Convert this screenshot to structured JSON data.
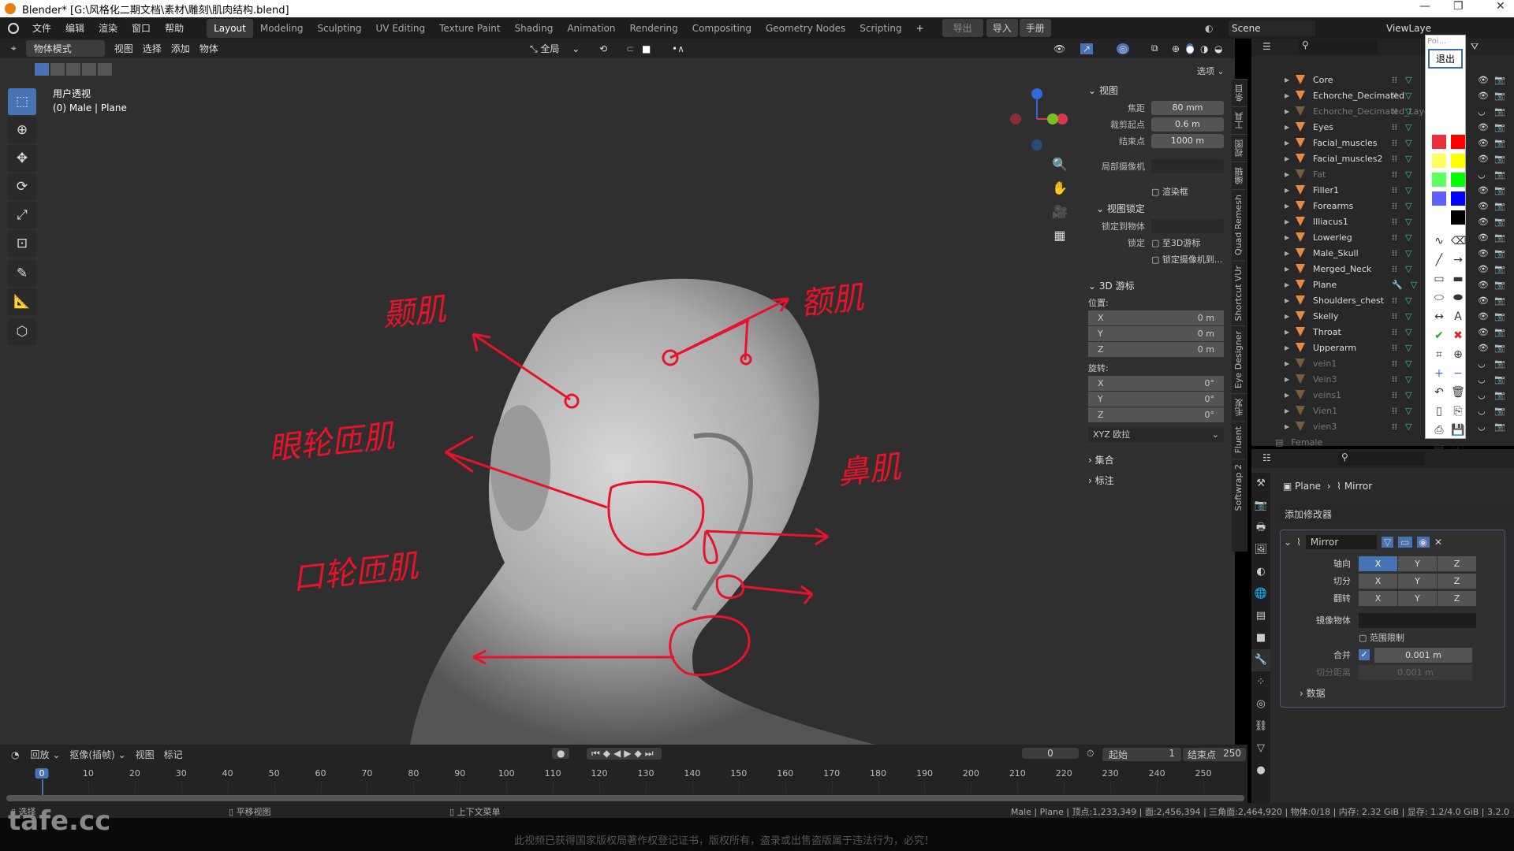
{
  "window": {
    "title": "Blender* [G:\\风格化二期文档\\素材\\雕刻\\肌肉结构.blend]",
    "minimize": "—",
    "restore": "❐",
    "close": "✕"
  },
  "menu": [
    "文件",
    "编辑",
    "渲染",
    "窗口",
    "帮助"
  ],
  "workspaces": [
    {
      "label": "Layout",
      "active": true
    },
    {
      "label": "Modeling"
    },
    {
      "label": "Sculpting"
    },
    {
      "label": "UV Editing"
    },
    {
      "label": "Texture Paint"
    },
    {
      "label": "Shading"
    },
    {
      "label": "Animation"
    },
    {
      "label": "Rendering"
    },
    {
      "label": "Compositing"
    },
    {
      "label": "Geometry Nodes"
    },
    {
      "label": "Scripting"
    }
  ],
  "topbar": {
    "add_ws": "+",
    "export": "导出",
    "import": "导入",
    "manual": "手册",
    "scene": "Scene",
    "view_layer": "ViewLaye"
  },
  "vp_header": {
    "mode": "物体模式",
    "items": [
      "视图",
      "选择",
      "添加",
      "物体"
    ],
    "transform": "全局",
    "options": "选项"
  },
  "viewport": {
    "view_name": "用户透视",
    "object_info": "(0) Male | Plane",
    "annotations": {
      "temporalis": "颞肌",
      "frontalis": "额肌",
      "orbicularis_oculi": "眼轮匝肌",
      "nasalis": "鼻肌",
      "orbicularis_oris": "口轮匝肌"
    },
    "annotation_color": "#e8132a",
    "gizmo": {
      "x": "X",
      "y": "Y",
      "z": "Z"
    }
  },
  "npanel": {
    "view": {
      "title": "视图",
      "focal_label": "焦距",
      "focal": "80 mm",
      "clip_start_label": "裁剪起点",
      "clip_start": "0.6 m",
      "clip_end_label": "结束点",
      "clip_end": "1000 m",
      "local_camera": "局部摄像机",
      "render_region": "渲染框",
      "lock": {
        "title": "视图锁定",
        "lock_object": "锁定到物体",
        "lock_label": "锁定",
        "to_cursor": "至3D游标",
        "lock_camera": "锁定摄像机到..."
      }
    },
    "cursor": {
      "title": "3D 游标",
      "location": "位置:",
      "loc": [
        {
          "axis": "X",
          "value": "0 m"
        },
        {
          "axis": "Y",
          "value": "0 m"
        },
        {
          "axis": "Z",
          "value": "0 m"
        }
      ],
      "rotation": "旋转:",
      "rot": [
        {
          "axis": "X",
          "value": "0°"
        },
        {
          "axis": "Y",
          "value": "0°"
        },
        {
          "axis": "Z",
          "value": "0°"
        }
      ],
      "mode": "XYZ 欧拉"
    },
    "collections": "集合",
    "annotations": "标注"
  },
  "ntabs": [
    "条目",
    "工具",
    "视图",
    "编辑",
    "Quad Remesh",
    "Shortcut VUr",
    "Eye Designer",
    "毛发",
    "Fluent",
    "Softwrap 2"
  ],
  "outliner": {
    "items": [
      {
        "name": "Core"
      },
      {
        "name": "Echorche_Decimated"
      },
      {
        "name": "Echorche_Decimated_Layer",
        "dim": true
      },
      {
        "name": "Eyes"
      },
      {
        "name": "Facial_muscles"
      },
      {
        "name": "Facial_muscles2"
      },
      {
        "name": "Fat",
        "dim": true
      },
      {
        "name": "Filler1"
      },
      {
        "name": "Forearms"
      },
      {
        "name": "Illiacus1"
      },
      {
        "name": "Lowerleg"
      },
      {
        "name": "Male_Skull"
      },
      {
        "name": "Merged_Neck"
      },
      {
        "name": "Plane",
        "modifier": "wrench-icon"
      },
      {
        "name": "Shoulders_chest"
      },
      {
        "name": "Skelly"
      },
      {
        "name": "Throat"
      },
      {
        "name": "Upperarm"
      },
      {
        "name": "vein1",
        "dim": true
      },
      {
        "name": "Vein3",
        "dim": true
      },
      {
        "name": "veins1",
        "dim": true
      },
      {
        "name": "Vien1",
        "dim": true
      },
      {
        "name": "vien3",
        "dim": true
      }
    ],
    "collection": "Female"
  },
  "palette": {
    "title": "Poi...",
    "exit": "退出",
    "colors": [
      "#e8303a",
      "#ff0000",
      "#ffff60",
      "#ffff00",
      "#60ff60",
      "#00ff00",
      "#6060ff",
      "#0000ff",
      "#ffffff",
      "#000000"
    ]
  },
  "properties": {
    "object": "Plane",
    "modifier_name": "Mirror",
    "add_modifier": "添加修改器",
    "axis_label": "轴向",
    "bisect_label": "切分",
    "flip_label": "翻转",
    "axes": [
      "X",
      "Y",
      "Z"
    ],
    "axis_active": "X",
    "mirror_object": "镜像物体",
    "clipping": "范围限制",
    "merge": "合并",
    "merge_value": "0.001 m",
    "bisect_distance": "切分距离",
    "bisect_value": "0.001 m",
    "data": "数据"
  },
  "timeline": {
    "playback": "回放",
    "keying": "抠像(插帧)",
    "view": "视图",
    "marker": "标记",
    "current": "0",
    "start_label": "起始",
    "start": "1",
    "end_label": "结束点",
    "end": "250",
    "ticks": [
      0,
      10,
      20,
      30,
      40,
      50,
      60,
      70,
      80,
      90,
      100,
      110,
      120,
      130,
      140,
      150,
      160,
      170,
      180,
      190,
      200,
      210,
      220,
      230,
      240,
      250
    ]
  },
  "statusbar": {
    "select": "选择",
    "pan": "平移视图",
    "context": "上下文菜单",
    "stats": "Male | Plane | 顶点:1,233,349 | 面:2,456,394 | 三角面:2,464,920 | 物体:0/18 | 内存: 2.32 GiB | 显存: 1.2/4.0 GiB | 3.2.0"
  },
  "watermark": {
    "logo": "tafe.cc",
    "notice": "此视频已获得国家版权局著作权登记证书，版权所有，盗录或出售盗版属于违法行为，必究！"
  }
}
